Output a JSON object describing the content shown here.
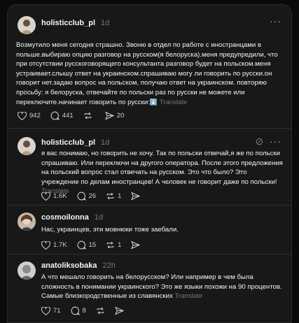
{
  "posts": [
    {
      "username": "holisticclub_pl",
      "time": "1d",
      "text": "Возмутило меня сегодня страшно. Звоню в отдел по работе с иностранцами в польше.выбираю опцию разговор на русском(я белоруска).меня предупредили, что при отсутствии русскоговорящего консультанта разговор будет на польском.меня устраивает.слышу ответ на украинском.спрашиваю могу ли говорить по русски.он говорит нет.задаю вопрос на польском, получаю ответ на украинском. повторяю просьбу: я белоруска, отвечайте по польски раз по русски не можете или переключите.начинает говорить по русски:",
      "emoji": "⬇️",
      "translate": "Translate",
      "likes": "942",
      "comments": "441",
      "reposts": "",
      "shares": "20"
    },
    {
      "username": "holisticclub_pl",
      "time": "1d",
      "text": "я вас понимаю, но говорить не хочу. Так по польски отвечай,я же по польски спрашиваю. Или переключи на другого оператора. После этого предложения на польский вопрос стал отвечать на русском. Это что было? Это учреждение по делам иностранцев! А человек не говорит даже по польски!",
      "translate": "Translate",
      "likes": "1.6K",
      "comments": "26",
      "reposts": "1",
      "shares": ""
    },
    {
      "username": "cosmoilonna",
      "time": "1d",
      "text": "Нас, украинцев, эти мовнюки тоже заебали.",
      "likes": "1.7K",
      "comments": "15",
      "reposts": "1",
      "shares": ""
    },
    {
      "username": "anatoliksobaka",
      "time": "22h",
      "text": "А что мешало говорить на белорусском? Или например в чем была сложность в понимании украинского? Это же языки похожи на 90 процентов. Самые близкородственные из славянских",
      "translate": "Translate",
      "likes": "71",
      "comments": "8",
      "reposts": "",
      "shares": ""
    }
  ],
  "icons": {
    "more": "more-icon",
    "heart": "heart-icon",
    "comment": "comment-icon",
    "repost": "repost-icon",
    "share": "share-icon",
    "author": "author-edited-icon"
  }
}
